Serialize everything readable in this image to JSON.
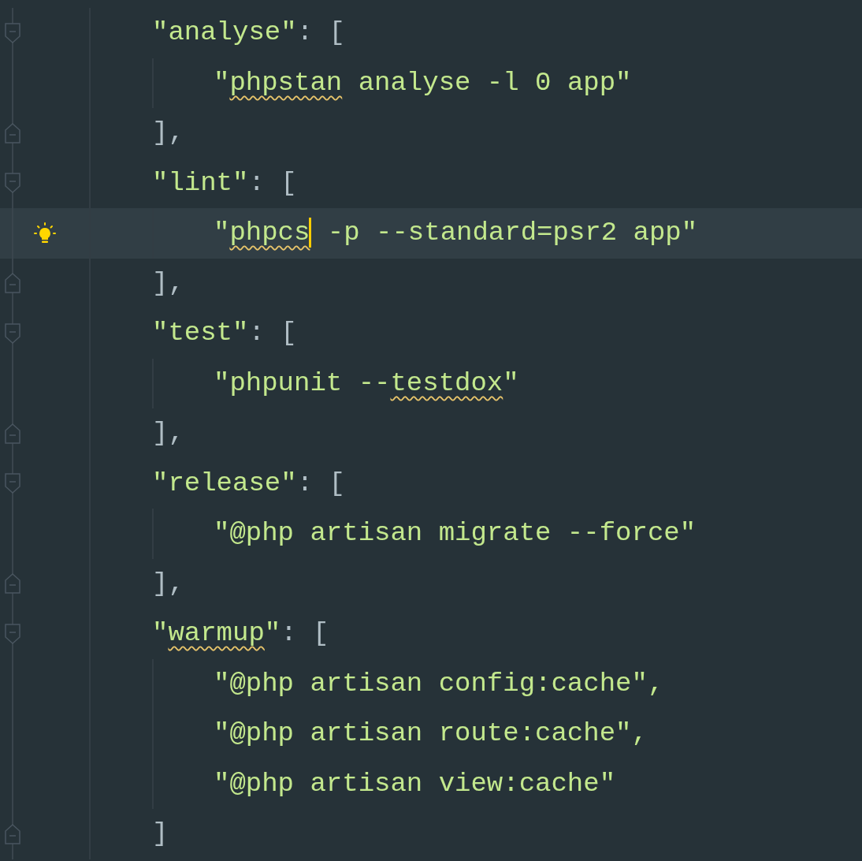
{
  "blocks": [
    {
      "key": [
        {
          "text": "\"analyse\"",
          "warning": false,
          "caret": false
        }
      ],
      "open": ": [",
      "close": "],",
      "items": [
        {
          "current": false,
          "hint": false,
          "segments": [
            {
              "text": "\"",
              "warning": false,
              "caret": false
            },
            {
              "text": "phpstan",
              "warning": true,
              "caret": false
            },
            {
              "text": " analyse -l 0 app\"",
              "warning": false,
              "caret": false
            }
          ]
        }
      ]
    },
    {
      "key": [
        {
          "text": "\"lint\"",
          "warning": false,
          "caret": false
        }
      ],
      "open": ": [",
      "close": "],",
      "items": [
        {
          "current": true,
          "hint": true,
          "segments": [
            {
              "text": "\"",
              "warning": false,
              "caret": false
            },
            {
              "text": "phpcs",
              "warning": true,
              "caret": true
            },
            {
              "text": " -p --standard=psr2 app\"",
              "warning": false,
              "caret": false
            }
          ]
        }
      ]
    },
    {
      "key": [
        {
          "text": "\"test\"",
          "warning": false,
          "caret": false
        }
      ],
      "open": ": [",
      "close": "],",
      "items": [
        {
          "current": false,
          "hint": false,
          "segments": [
            {
              "text": "\"phpunit --",
              "warning": false,
              "caret": false
            },
            {
              "text": "testdox",
              "warning": true,
              "caret": false
            },
            {
              "text": "\"",
              "warning": false,
              "caret": false
            }
          ]
        }
      ]
    },
    {
      "key": [
        {
          "text": "\"release\"",
          "warning": false,
          "caret": false
        }
      ],
      "open": ": [",
      "close": "],",
      "items": [
        {
          "current": false,
          "hint": false,
          "segments": [
            {
              "text": "\"@php artisan migrate --force\"",
              "warning": false,
              "caret": false
            }
          ]
        }
      ]
    },
    {
      "key": [
        {
          "text": "\"",
          "warning": false,
          "caret": false
        },
        {
          "text": "warmup",
          "warning": true,
          "caret": false
        },
        {
          "text": "\"",
          "warning": false,
          "caret": false
        }
      ],
      "open": ": [",
      "close": "]",
      "items": [
        {
          "current": false,
          "hint": false,
          "segments": [
            {
              "text": "\"@php artisan config:cache\",",
              "warning": false,
              "caret": false
            }
          ]
        },
        {
          "current": false,
          "hint": false,
          "segments": [
            {
              "text": "\"@php artisan route:cache\",",
              "warning": false,
              "caret": false
            }
          ]
        },
        {
          "current": false,
          "hint": false,
          "segments": [
            {
              "text": "\"@php artisan view:cache\"",
              "warning": false,
              "caret": false
            }
          ]
        }
      ]
    }
  ]
}
